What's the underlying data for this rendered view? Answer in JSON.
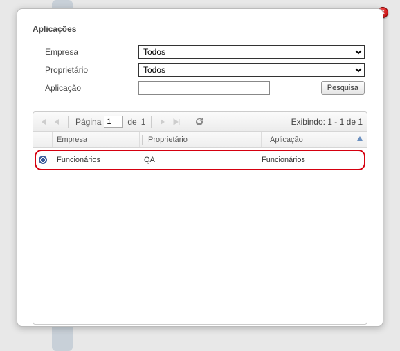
{
  "dialog": {
    "title": "Aplicações"
  },
  "form": {
    "empresa_label": "Empresa",
    "proprietario_label": "Proprietário",
    "aplicacao_label": "Aplicação",
    "empresa_value": "Todos",
    "proprietario_value": "Todos",
    "aplicacao_value": "",
    "search_label": "Pesquisa"
  },
  "toolbar": {
    "page_label": "Página",
    "page_value": "1",
    "of_label": "de",
    "total_pages": "1",
    "display_info": "Exibindo: 1 - 1 de 1"
  },
  "columns": {
    "empresa": "Empresa",
    "proprietario": "Proprietário",
    "aplicacao": "Aplicação"
  },
  "rows": [
    {
      "selected": true,
      "empresa": "Funcionários",
      "proprietario": "QA",
      "aplicacao": "Funcionários"
    }
  ]
}
